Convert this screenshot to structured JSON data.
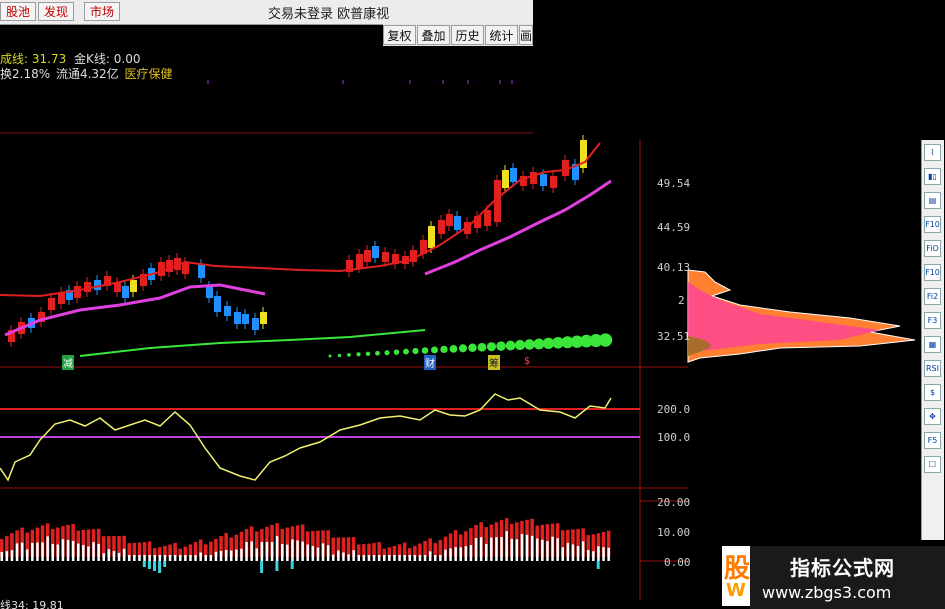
{
  "tabs": [
    "股池",
    "发现",
    "市场"
  ],
  "window_title": "交易未登录  欧普康视",
  "toolbar": [
    "复权",
    "叠加",
    "历史",
    "统计",
    "画"
  ],
  "info": {
    "line1_a": "成线: 31.73",
    "line1_b": "金K线: 0.00",
    "line2_a": "换2.18%",
    "line2_b": "流通4.32亿",
    "line2_c": "医疗保健"
  },
  "price_ticks": [
    "49.54",
    "44.59",
    "40.13",
    "2",
    "32.51"
  ],
  "indicator_ticks": [
    "200.0",
    "100.0"
  ],
  "volume_ticks": [
    "20.00",
    "10.00",
    "0.00"
  ],
  "bottom_label": "线34: 19.81",
  "markers": [
    "减",
    "财",
    "筹",
    "$"
  ],
  "side_icons": [
    "line",
    "candle",
    "bar",
    "F10",
    "Fin",
    "F10",
    "F2",
    "F3",
    "vol",
    "RSI",
    "$",
    "move",
    "F5",
    "tool"
  ],
  "watermark": {
    "title": "指标公式网",
    "url": "www.zbgs3.com",
    "logo_top": "股",
    "logo_bottom": "W"
  },
  "colors": {
    "tab_text": "#c00000",
    "bull": "#e32020",
    "bear": "#2090ff",
    "ma_pink": "#e040e0",
    "ma_red": "#e02020",
    "green_dots": "#39e639",
    "yellow_line": "#f2f070",
    "cyan": "#38d4e0"
  }
}
